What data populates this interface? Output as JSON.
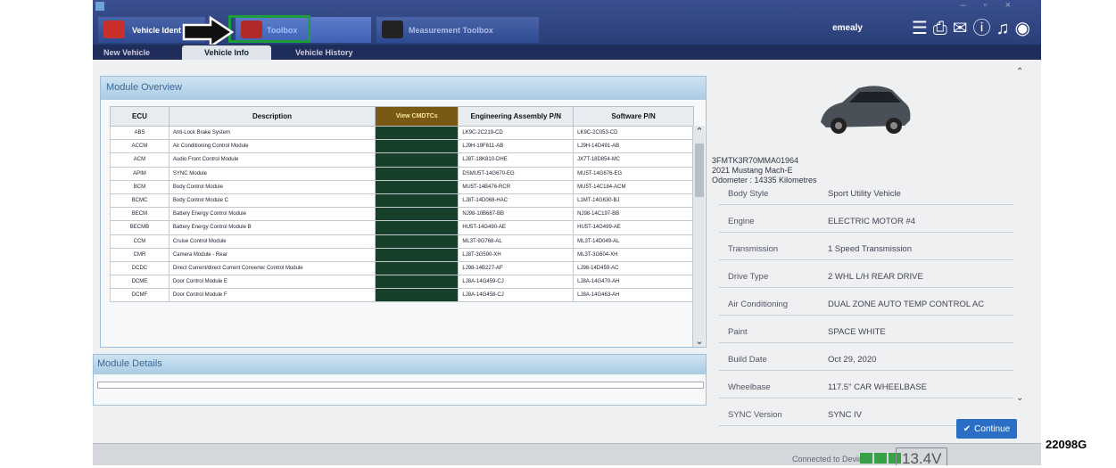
{
  "tabs": {
    "vehicle": "Vehicle Ident",
    "toolbox": "Toolbox",
    "measurement": "Measurement Toolbox"
  },
  "user": "emealy",
  "subtabs": [
    "New Vehicle",
    "Vehicle Info",
    "Vehicle History"
  ],
  "overview": {
    "title": "Module Overview",
    "columns": [
      "ECU",
      "Description",
      "View CMDTCs",
      "Engineering Assembly P/N",
      "Software P/N"
    ],
    "rows": [
      {
        "ecu": "ABS",
        "desc": "Anti-Lock Brake System",
        "eng": "LK9C-2C219-CD",
        "sw": "LK9C-2C053-CD"
      },
      {
        "ecu": "ACCM",
        "desc": "Air Conditioning Control Module",
        "eng": "LJ9H-19F611-AB",
        "sw": "LJ9H-14D491-AB"
      },
      {
        "ecu": "ACM",
        "desc": "Audio Front Control Module",
        "eng": "LJ8T-18K810-DHE",
        "sw": "JX7T-18D854-MC"
      },
      {
        "ecu": "APIM",
        "desc": "SYNC Module",
        "eng": "DSMU5T-14G670-EG",
        "sw": "MU5T-14G676-EG"
      },
      {
        "ecu": "BCM",
        "desc": "Body Control Module",
        "eng": "MU5T-14B476-RCR",
        "sw": "MU5T-14C184-ACM"
      },
      {
        "ecu": "BCMC",
        "desc": "Body Control Module C",
        "eng": "LJ8T-14D068-HAC",
        "sw": "L1MT-14G630-BJ"
      },
      {
        "ecu": "BECM",
        "desc": "Battery Energy Control Module",
        "eng": "NJ98-10B687-BB",
        "sw": "NJ98-14C197-BB"
      },
      {
        "ecu": "BECMB",
        "desc": "Battery Energy Control Module B",
        "eng": "HU5T-14G490-AE",
        "sw": "HU5T-14G499-AE"
      },
      {
        "ecu": "CCM",
        "desc": "Cruise Control Module",
        "eng": "ML3T-9G768-AL",
        "sw": "ML3T-14D049-AL"
      },
      {
        "ecu": "CMR",
        "desc": "Camera Module - Rear",
        "eng": "LJ8T-3G590-XH",
        "sw": "ML3T-3G604-XH"
      },
      {
        "ecu": "DCDC",
        "desc": "Direct Current/direct Current Converter Control Module",
        "eng": "LJ98-14B227-AF",
        "sw": "LJ98-14D459-AC"
      },
      {
        "ecu": "DCME",
        "desc": "Door Control Module E",
        "eng": "LJ8A-14G459-CJ",
        "sw": "LJ8A-14G470-AH"
      },
      {
        "ecu": "DCMF",
        "desc": "Door Control Module F",
        "eng": "LJ8A-14G458-CJ",
        "sw": "LJ8A-14G463-AH"
      }
    ]
  },
  "details_title": "Module Details",
  "vehicle": {
    "vin": "3FMTK3R70MMA01964",
    "model": "2021 Mustang Mach-E",
    "odometer": "Odometer : 14335 Kilometres",
    "properties": [
      {
        "key": "Body Style",
        "value": "Sport Utility Vehicle"
      },
      {
        "key": "Engine",
        "value": "ELECTRIC MOTOR #4"
      },
      {
        "key": "Transmission",
        "value": "1 Speed Transmission"
      },
      {
        "key": "Drive Type",
        "value": "2 WHL L/H REAR DRIVE"
      },
      {
        "key": "Air Conditioning",
        "value": "DUAL ZONE AUTO TEMP CONTROL AC"
      },
      {
        "key": "Paint",
        "value": "SPACE WHITE"
      },
      {
        "key": "Build Date",
        "value": "Oct 29, 2020"
      },
      {
        "key": "Wheelbase",
        "value": "117.5\" CAR WHEELBASE"
      },
      {
        "key": "SYNC Version",
        "value": "SYNC IV"
      }
    ]
  },
  "continue_label": "Continue",
  "status": {
    "connected": "Connected to Device",
    "voltage": "13.4V"
  },
  "image_tag": "22098G",
  "colors": {
    "highlight_box": "#1e9e3b",
    "header_blue": "#2a3f78",
    "continue": "#2b6fc4"
  }
}
